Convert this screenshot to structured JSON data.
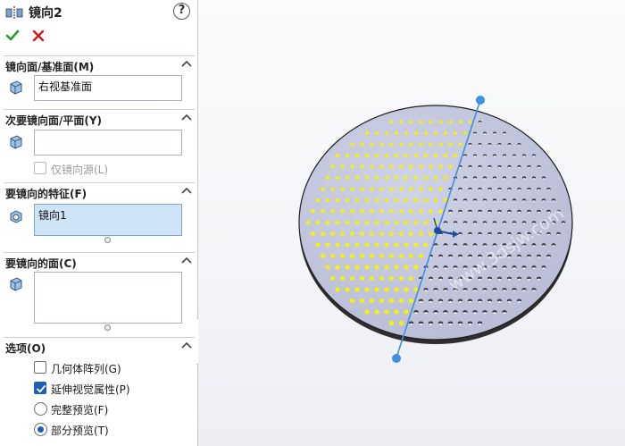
{
  "panel": {
    "title": "镜向2",
    "help_label": "?"
  },
  "groups": {
    "mirror_face": {
      "title": "镜向面/基准面(M)",
      "value": "右视基准面"
    },
    "secondary_face": {
      "title": "次要镜向面/平面(Y)",
      "value": "",
      "checkbox_label": "仅镜向源(L)",
      "checkbox_checked": false
    },
    "features": {
      "title": "要镜向的特征(F)",
      "items": [
        "镜向1"
      ]
    },
    "faces": {
      "title": "要镜向的面(C)",
      "items": []
    },
    "options": {
      "title": "选项(O)",
      "geometry_pattern": {
        "label": "几何体阵列(G)",
        "checked": false
      },
      "propagate_visual": {
        "label": "延伸视觉属性(P)",
        "checked": true
      },
      "full_preview": {
        "label": "完整预览(F)",
        "selected": false
      },
      "partial_preview": {
        "label": "部分预览(T)",
        "selected": true
      }
    }
  },
  "viewport": {
    "watermark": "www.3dsjw.com",
    "colors": {
      "disc_fill": "#c3c7de",
      "disc_rim": "#2a2a2a",
      "preview_hole": "#f4f20a",
      "mirror_line": "#3d8fe0",
      "accept": "#2a9a2a",
      "cancel": "#d01818"
    }
  }
}
